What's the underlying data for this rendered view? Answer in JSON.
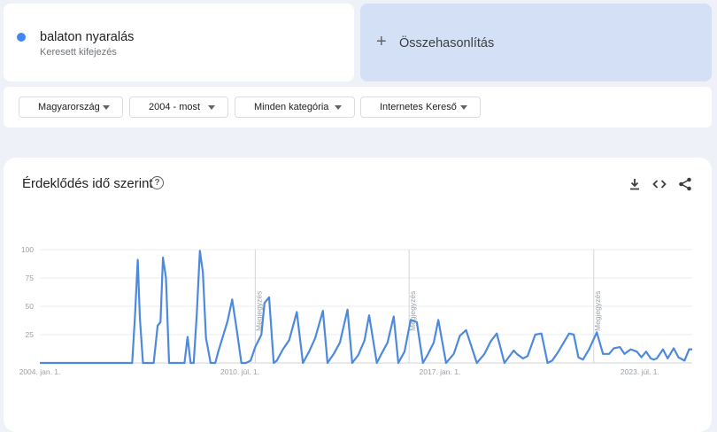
{
  "search_term": {
    "name": "balaton nyaralás",
    "subtitle": "Keresett kifejezés",
    "color": "#4285f4"
  },
  "compare": {
    "label": "Összehasonlítás",
    "icon": "plus-icon"
  },
  "filters": [
    {
      "label": "Magyarország"
    },
    {
      "label": "2004 - most"
    },
    {
      "label": "Minden kategória"
    },
    {
      "label": "Internetes Kereső"
    }
  ],
  "chart_card": {
    "title": "Érdeklődés idő szerint",
    "icons": [
      "help-icon",
      "download-icon",
      "embed-code-icon",
      "share-icon"
    ]
  },
  "chart_data": {
    "type": "line",
    "title": "",
    "xlabel": "",
    "ylabel": "",
    "ylim": [
      0,
      100
    ],
    "yticks": [
      25,
      50,
      75,
      100
    ],
    "xtick_labels": [
      "2004. jan. 1.",
      "2010. júl. 1.",
      "2017. jan. 1.",
      "2023. júl. 1."
    ],
    "grid": true,
    "color": "#4d89dd",
    "annotations": [
      {
        "label": "Megjegyzés",
        "x": 2011.0
      },
      {
        "label": "Megjegyzés",
        "x": 2016.0
      },
      {
        "label": "Megjegyzés",
        "x": 2022.0
      }
    ],
    "x": [
      2004.0,
      2007.0,
      2007.09,
      2007.18,
      2007.25,
      2007.35,
      2007.7,
      2007.83,
      2007.92,
      2008.0,
      2008.1,
      2008.2,
      2008.3,
      2008.7,
      2008.8,
      2008.9,
      2009.0,
      2009.1,
      2009.2,
      2009.3,
      2009.4,
      2009.55,
      2009.7,
      2009.8,
      2010.1,
      2010.25,
      2010.4,
      2010.55,
      2010.7,
      2010.85,
      2011.0,
      2011.2,
      2011.3,
      2011.45,
      2011.6,
      2011.7,
      2011.9,
      2012.1,
      2012.35,
      2012.55,
      2012.75,
      2012.95,
      2013.2,
      2013.35,
      2013.55,
      2013.75,
      2014.0,
      2014.15,
      2014.35,
      2014.55,
      2014.7,
      2014.95,
      2015.1,
      2015.3,
      2015.5,
      2015.65,
      2015.85,
      2016.05,
      2016.25,
      2016.45,
      2016.6,
      2016.8,
      2016.95,
      2017.2,
      2017.45,
      2017.65,
      2017.85,
      2018.2,
      2018.45,
      2018.65,
      2018.85,
      2019.1,
      2019.4,
      2019.5,
      2019.7,
      2019.85,
      2020.1,
      2020.3,
      2020.5,
      2020.65,
      2020.85,
      2021.2,
      2021.35,
      2021.5,
      2021.65,
      2021.85,
      2022.1,
      2022.3,
      2022.5,
      2022.65,
      2022.85,
      2023.0,
      2023.2,
      2023.4,
      2023.55,
      2023.7,
      2023.85,
      2023.95,
      2024.05,
      2024.25,
      2024.4,
      2024.6,
      2024.75,
      2024.95,
      2025.1,
      2025.2
    ],
    "values": [
      0,
      0,
      40,
      91,
      40,
      0,
      0,
      33,
      36,
      93,
      75,
      0,
      0,
      0,
      23,
      0,
      0,
      43,
      99,
      80,
      22,
      0,
      0,
      10,
      37,
      56,
      29,
      0,
      0,
      2,
      14,
      25,
      53,
      58,
      0,
      2,
      12,
      20,
      45,
      0,
      10,
      22,
      46,
      0,
      8,
      18,
      47,
      0,
      7,
      20,
      42,
      0,
      8,
      18,
      41,
      0,
      10,
      38,
      36,
      0,
      7,
      18,
      38,
      0,
      8,
      24,
      29,
      0,
      8,
      19,
      26,
      0,
      11,
      8,
      4,
      6,
      25,
      26,
      0,
      2,
      10,
      26,
      25,
      5,
      3,
      12,
      27,
      8,
      8,
      13,
      14,
      8,
      12,
      10,
      5,
      10,
      4,
      3,
      4,
      12,
      4,
      13,
      5,
      2,
      12,
      12
    ]
  }
}
